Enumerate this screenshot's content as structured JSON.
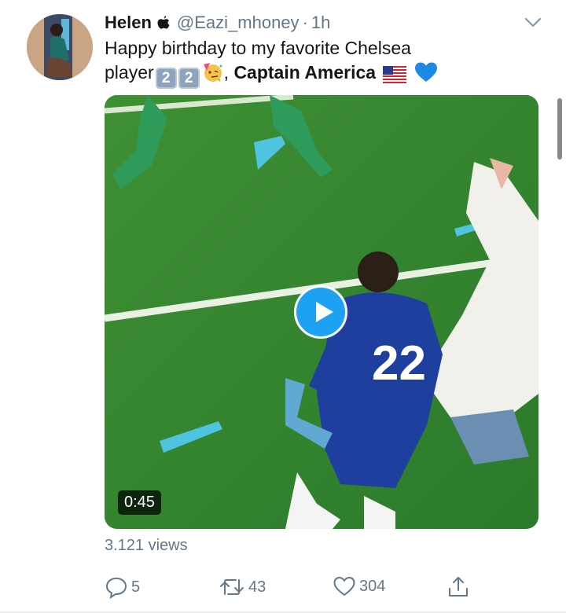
{
  "tweet": {
    "display_name": "Helen",
    "handle": "@Eazi_mhoney",
    "separator": "·",
    "time": "1h",
    "text_line1": "Happy birthday to my favorite Chelsea",
    "text_player": "player",
    "keycap_1": "2",
    "keycap_2": "2",
    "text_comma": ",",
    "text_bold": "Captain America",
    "emojis": [
      "partying-face",
      "us-flag",
      "blue-heart"
    ]
  },
  "video": {
    "duration": "0:45",
    "jersey_number": "22",
    "views": "3.121 views"
  },
  "actions": {
    "replies": "5",
    "retweets": "43",
    "likes": "304"
  },
  "colors": {
    "accent": "#1da1f2",
    "secondary_text": "#657786",
    "pitch": "#2f7d2e",
    "jersey": "#1f3f9e"
  },
  "icons": [
    "apple-icon",
    "chevron-down-icon",
    "play-icon",
    "reply-icon",
    "retweet-icon",
    "like-icon",
    "share-icon"
  ]
}
